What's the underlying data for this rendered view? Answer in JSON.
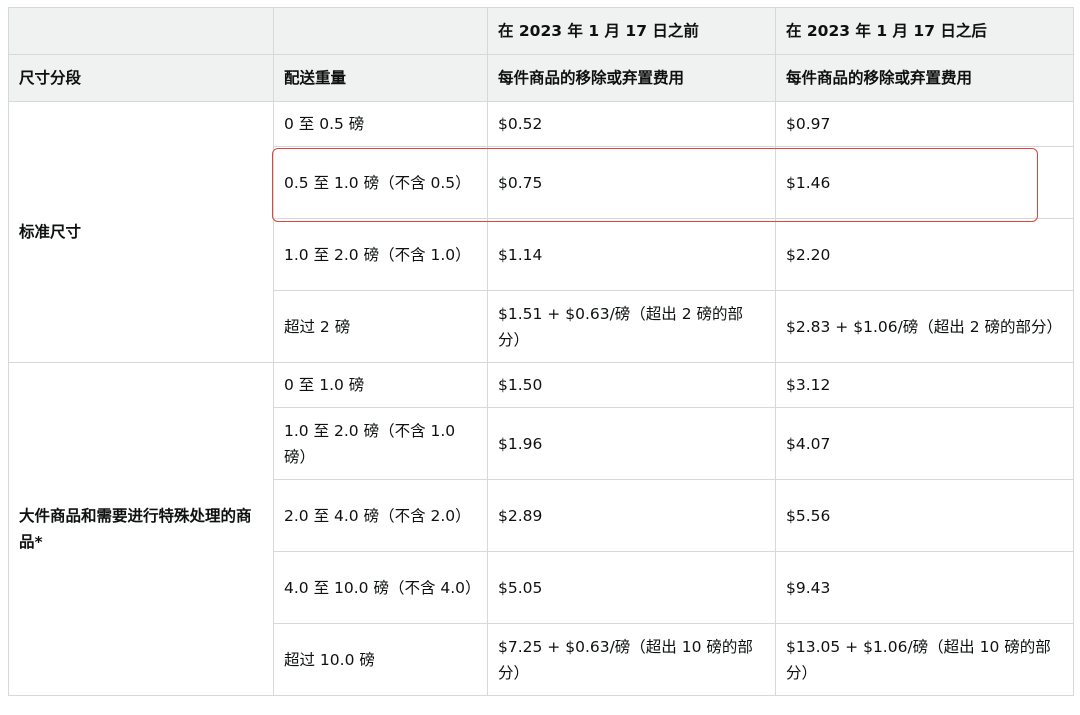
{
  "columns": {
    "before_period": "在 2023 年 1 月 17 日之前",
    "after_period": "在 2023 年 1 月 17 日之后",
    "size_tier": "尺寸分段",
    "shipping_weight": "配送重量",
    "fee_before": "每件商品的移除或弃置费用",
    "fee_after": "每件商品的移除或弃置费用"
  },
  "groups": [
    {
      "tier": "标准尺寸",
      "rows": [
        {
          "weight": "0 至 0.5 磅",
          "before": "$0.52",
          "after": "$0.97"
        },
        {
          "weight": "0.5 至 1.0 磅（不含 0.5）",
          "before": "$0.75",
          "after": "$1.46"
        },
        {
          "weight": "1.0 至 2.0 磅（不含 1.0）",
          "before": "$1.14",
          "after": "$2.20"
        },
        {
          "weight": "超过 2 磅",
          "before": "$1.51 + $0.63/磅（超出 2 磅的部分）",
          "after": "$2.83 + $1.06/磅（超出 2 磅的部分）"
        }
      ]
    },
    {
      "tier": "大件商品和需要进行特殊处理的商品*",
      "rows": [
        {
          "weight": "0 至 1.0 磅",
          "before": "$1.50",
          "after": "$3.12"
        },
        {
          "weight": "1.0 至 2.0 磅（不含 1.0 磅）",
          "before": "$1.96",
          "after": "$4.07"
        },
        {
          "weight": "2.0 至 4.0 磅（不含 2.0）",
          "before": "$2.89",
          "after": "$5.56"
        },
        {
          "weight": "4.0 至 10.0 磅（不含 4.0）",
          "before": "$5.05",
          "after": "$9.43"
        },
        {
          "weight": "超过 10.0 磅",
          "before": "$7.25 + $0.63/磅（超出 10 磅的部分）",
          "after": "$13.05 + $1.06/磅（超出 10 磅的部分）"
        }
      ]
    }
  ],
  "highlight_color": "#e0453a"
}
